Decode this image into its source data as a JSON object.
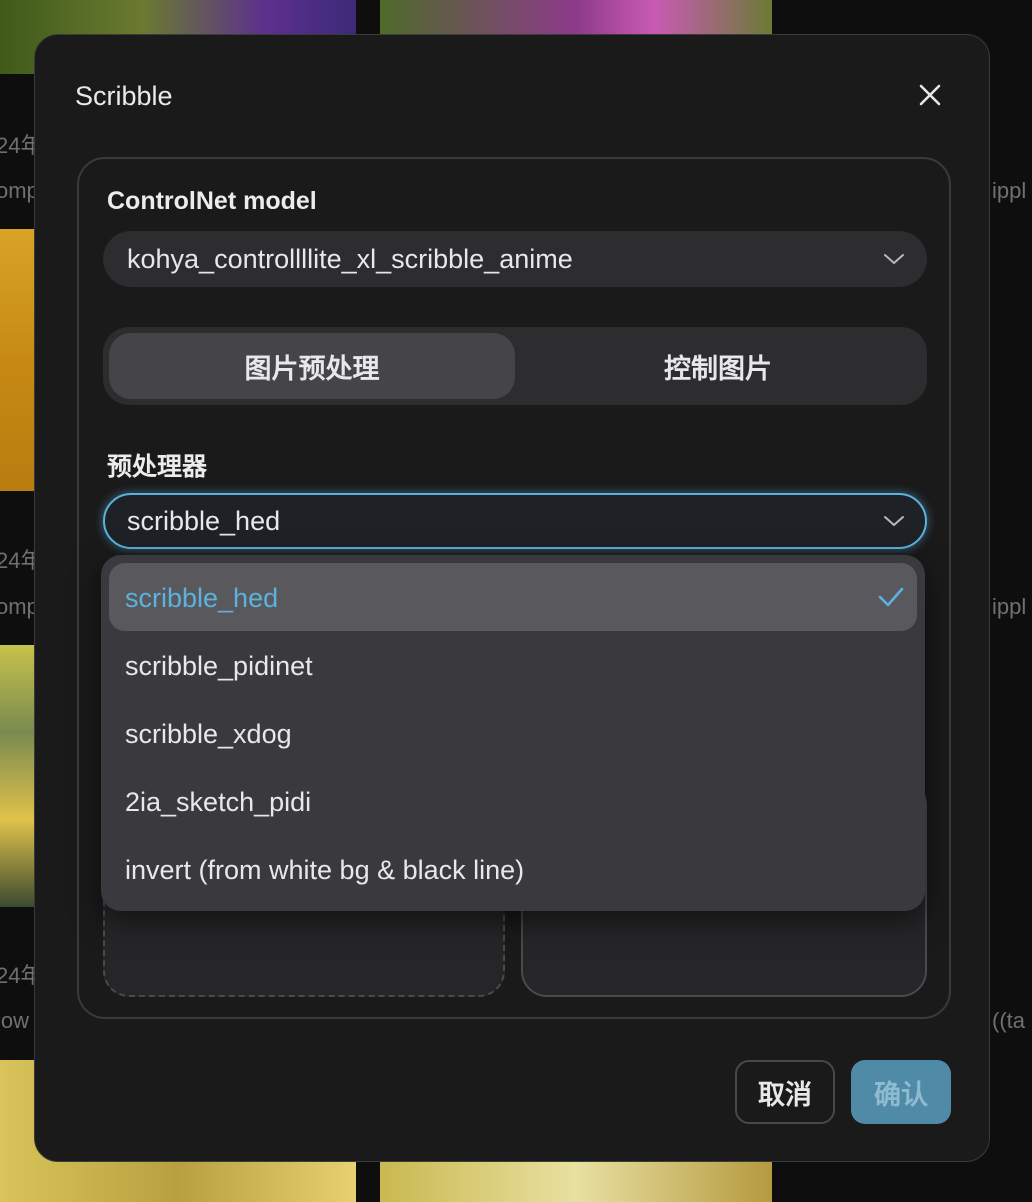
{
  "background": {
    "texts": [
      "24年",
      "omp",
      "24年",
      "omp",
      "24年",
      "low",
      "ippl",
      "ippl",
      "((ta"
    ]
  },
  "dialog": {
    "title": "Scribble",
    "close_icon": "close-icon",
    "model_section": {
      "label": "ControlNet model",
      "selected": "kohya_controllllite_xl_scribble_anime"
    },
    "tabs": [
      {
        "label": "图片预处理",
        "active": true
      },
      {
        "label": "控制图片",
        "active": false
      }
    ],
    "preprocessor_section": {
      "label": "预处理器",
      "selected": "scribble_hed",
      "options": [
        {
          "label": "scribble_hed",
          "selected": true
        },
        {
          "label": "scribble_pidinet",
          "selected": false
        },
        {
          "label": "scribble_xdog",
          "selected": false
        },
        {
          "label": "2ia_sketch_pidi",
          "selected": false
        },
        {
          "label": "invert (from white bg & black line)",
          "selected": false
        }
      ]
    },
    "buttons": {
      "cancel": "取消",
      "confirm": "确认"
    }
  },
  "colors": {
    "accent": "#5ab2dd",
    "confirm_button": "#4f8aa6",
    "dialog_bg": "#1a1a1b",
    "dropdown_bg": "#3a3a3e"
  }
}
